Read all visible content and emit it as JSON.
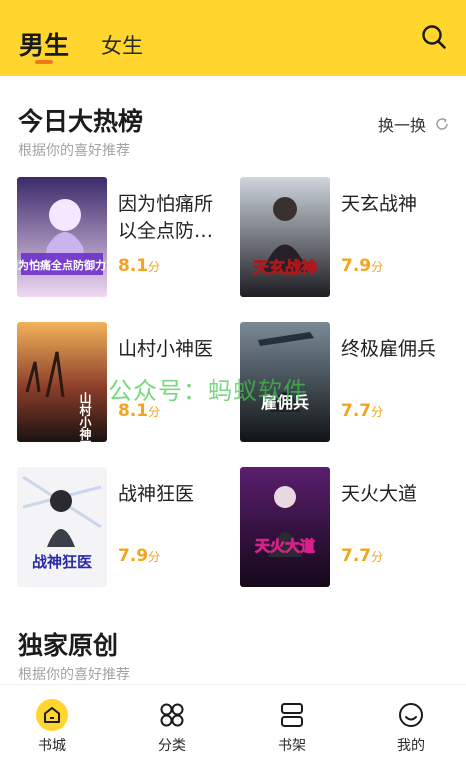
{
  "header": {
    "tabs": [
      "男生",
      "女生"
    ],
    "active_tab": "男生",
    "search_icon": "search-icon",
    "background": "#FFD52E",
    "indicator_color": "#F07A1A"
  },
  "hot": {
    "title": "今日大热榜",
    "subtitle": "根据你的喜好推荐",
    "swap_label": "换一换",
    "swap_icon": "refresh-icon",
    "books": [
      {
        "title": "因为怕痛所以全点防御力了",
        "score": "8.1",
        "unit": "分",
        "cover_text": "因为怕痛全点防御力了"
      },
      {
        "title": "天玄战神",
        "score": "7.9",
        "unit": "分",
        "cover_text": "天玄战神"
      },
      {
        "title": "山村小神医",
        "score": "8.1",
        "unit": "分",
        "cover_text": "山村小神医"
      },
      {
        "title": "终极雇佣兵",
        "score": "7.7",
        "unit": "分",
        "cover_text": "雇佣兵"
      },
      {
        "title": "战神狂医",
        "score": "7.9",
        "unit": "分",
        "cover_text": "战神狂医"
      },
      {
        "title": "天火大道",
        "score": "7.7",
        "unit": "分",
        "cover_text": "天火大道"
      }
    ]
  },
  "exclusive": {
    "title": "独家原创",
    "subtitle": "根据你的喜好推荐"
  },
  "watermark": "公众号：蚂蚁软件",
  "score_color": "#F5A31A",
  "nav": [
    {
      "label": "书城",
      "icon": "home-icon",
      "active": true
    },
    {
      "label": "分类",
      "icon": "category-icon",
      "active": false
    },
    {
      "label": "书架",
      "icon": "bookshelf-icon",
      "active": false
    },
    {
      "label": "我的",
      "icon": "profile-icon",
      "active": false
    }
  ]
}
